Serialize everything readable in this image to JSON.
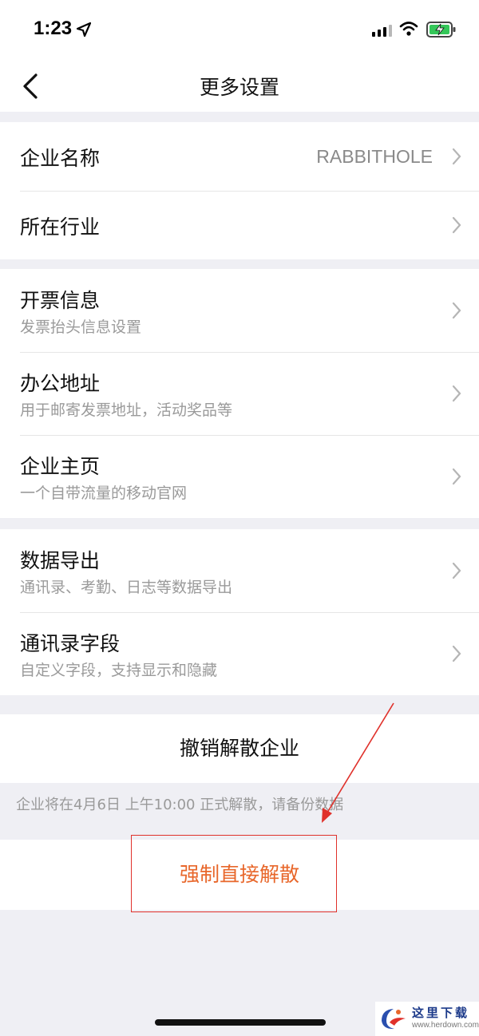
{
  "status_bar": {
    "time": "1:23"
  },
  "nav": {
    "title": "更多设置",
    "back_icon": "chevron-left-icon"
  },
  "group1": {
    "company_name": {
      "label": "企业名称",
      "value": "RABBITHOLE"
    },
    "industry": {
      "label": "所在行业"
    }
  },
  "group2": {
    "invoice": {
      "label": "开票信息",
      "sub": "发票抬头信息设置"
    },
    "office": {
      "label": "办公地址",
      "sub": "用于邮寄发票地址，活动奖品等"
    },
    "homepage": {
      "label": "企业主页",
      "sub": "一个自带流量的移动官网"
    }
  },
  "group3": {
    "export": {
      "label": "数据导出",
      "sub": "通讯录、考勤、日志等数据导出"
    },
    "fields": {
      "label": "通讯录字段",
      "sub": "自定义字段，支持显示和隐藏"
    }
  },
  "actions": {
    "revoke_label": "撤销解散企业",
    "notice": "企业将在4月6日 上午10:00 正式解散，请备份数据",
    "force_label": "强制直接解散"
  },
  "watermark": {
    "text": "这里下载",
    "url": "www.herdown.com"
  },
  "colors": {
    "danger": "#e8672b",
    "annotation": "#e0312b",
    "background": "#efeff4"
  }
}
